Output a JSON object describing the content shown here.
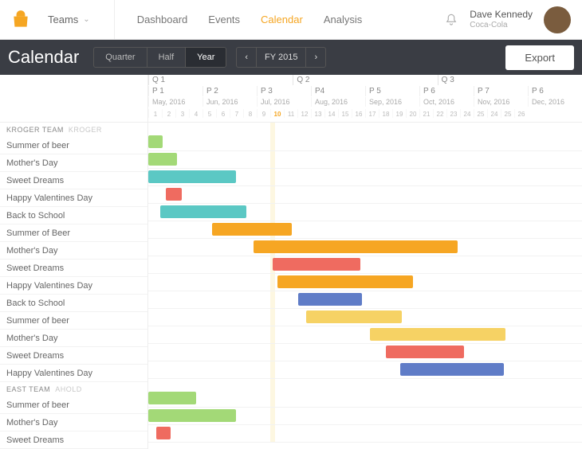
{
  "topbar": {
    "teams_label": "Teams",
    "nav": [
      "Dashboard",
      "Events",
      "Calendar",
      "Analysis"
    ],
    "nav_active": 2,
    "user_name": "Dave Kennedy",
    "user_org": "Coca-Cola"
  },
  "header": {
    "title": "Calendar",
    "segments": [
      "Quarter",
      "Half",
      "Year"
    ],
    "segment_active": 2,
    "period_label": "FY 2015",
    "export_label": "Export"
  },
  "timeline": {
    "quarters": [
      "Q 1",
      "Q 2",
      "Q 3"
    ],
    "periods": [
      "P 1",
      "P 2",
      "P 3",
      "P4",
      "P 5",
      "P 6",
      "P 7",
      "P 6"
    ],
    "months": [
      "May, 2016",
      "Jun, 2016",
      "Jul, 2016",
      "Aug, 2016",
      "Sep, 2016",
      "Oct, 2016",
      "Nov, 2016",
      "Dec, 2016"
    ],
    "days": [
      "1",
      "2",
      "3",
      "4",
      "5",
      "6",
      "7",
      "8",
      "9",
      "10",
      "11",
      "12",
      "13",
      "14",
      "15",
      "16",
      "17",
      "18",
      "19",
      "20",
      "21",
      "22",
      "23",
      "24",
      "25",
      "24",
      "25",
      "26"
    ],
    "day_highlight_index": 9
  },
  "groups": [
    {
      "name": "KROGER TEAM",
      "sub": "KROGER",
      "rows": [
        {
          "label": "Summer of beer",
          "bars": [
            {
              "start": 0,
              "len": 18,
              "cls": "c-green"
            }
          ]
        },
        {
          "label": "Mother's Day",
          "bars": [
            {
              "start": 0,
              "len": 36,
              "cls": "c-green"
            }
          ]
        },
        {
          "label": "Sweet Dreams",
          "bars": [
            {
              "start": 0,
              "len": 110,
              "cls": "c-teal"
            }
          ]
        },
        {
          "label": "Happy Valentines Day",
          "bars": [
            {
              "start": 22,
              "len": 20,
              "cls": "c-red"
            }
          ]
        },
        {
          "label": "Back to School",
          "bars": [
            {
              "start": 15,
              "len": 108,
              "cls": "c-teal"
            }
          ]
        },
        {
          "label": "Summer of Beer",
          "bars": [
            {
              "start": 80,
              "len": 100,
              "cls": "c-orange"
            }
          ]
        },
        {
          "label": "Mother's Day",
          "bars": [
            {
              "start": 132,
              "len": 256,
              "cls": "c-orange"
            }
          ]
        },
        {
          "label": "Sweet Dreams",
          "bars": [
            {
              "start": 156,
              "len": 110,
              "cls": "c-red"
            }
          ]
        },
        {
          "label": "Happy Valentines Day",
          "bars": [
            {
              "start": 162,
              "len": 170,
              "cls": "c-orange"
            }
          ]
        },
        {
          "label": "Back to School",
          "bars": [
            {
              "start": 188,
              "len": 80,
              "cls": "c-blue"
            }
          ]
        },
        {
          "label": "Summer of beer",
          "bars": [
            {
              "start": 198,
              "len": 120,
              "cls": "c-yellow"
            }
          ]
        },
        {
          "label": "Mother's Day",
          "bars": [
            {
              "start": 278,
              "len": 170,
              "cls": "c-yellow"
            }
          ]
        },
        {
          "label": "Sweet Dreams",
          "bars": [
            {
              "start": 298,
              "len": 98,
              "cls": "c-red"
            }
          ]
        },
        {
          "label": "Happy Valentines Day",
          "bars": [
            {
              "start": 316,
              "len": 130,
              "cls": "c-blue"
            }
          ]
        }
      ]
    },
    {
      "name": "EAST TEAM",
      "sub": "AHOLD",
      "rows": [
        {
          "label": "Summer of beer",
          "bars": [
            {
              "start": 0,
              "len": 60,
              "cls": "c-green"
            }
          ]
        },
        {
          "label": "Mother's Day",
          "bars": [
            {
              "start": 0,
              "len": 110,
              "cls": "c-green"
            }
          ]
        },
        {
          "label": "Sweet Dreams",
          "bars": [
            {
              "start": 10,
              "len": 18,
              "cls": "c-red"
            }
          ]
        }
      ]
    }
  ],
  "chart_data": {
    "type": "bar",
    "title": "Calendar Gantt – FY 2015 (Year view)",
    "x_unit": "week index (0 = P1 wk1, 4 weeks per period)",
    "x_range": [
      0,
      32
    ],
    "series": [
      {
        "group": "KROGER TEAM",
        "name": "Summer of beer",
        "start": 0,
        "end": 1,
        "color": "green"
      },
      {
        "group": "KROGER TEAM",
        "name": "Mother's Day",
        "start": 0,
        "end": 2,
        "color": "green"
      },
      {
        "group": "KROGER TEAM",
        "name": "Sweet Dreams",
        "start": 0,
        "end": 6.5,
        "color": "teal"
      },
      {
        "group": "KROGER TEAM",
        "name": "Happy Valentines Day",
        "start": 1.3,
        "end": 2.4,
        "color": "red"
      },
      {
        "group": "KROGER TEAM",
        "name": "Back to School",
        "start": 0.9,
        "end": 7.2,
        "color": "teal"
      },
      {
        "group": "KROGER TEAM",
        "name": "Summer of Beer",
        "start": 4.7,
        "end": 10.6,
        "color": "orange"
      },
      {
        "group": "KROGER TEAM",
        "name": "Mother's Day",
        "start": 7.8,
        "end": 22.8,
        "color": "orange"
      },
      {
        "group": "KROGER TEAM",
        "name": "Sweet Dreams",
        "start": 9.2,
        "end": 15.6,
        "color": "red"
      },
      {
        "group": "KROGER TEAM",
        "name": "Happy Valentines Day",
        "start": 9.5,
        "end": 19.5,
        "color": "orange"
      },
      {
        "group": "KROGER TEAM",
        "name": "Back to School",
        "start": 11.1,
        "end": 15.8,
        "color": "blue"
      },
      {
        "group": "KROGER TEAM",
        "name": "Summer of beer",
        "start": 11.6,
        "end": 18.7,
        "color": "yellow"
      },
      {
        "group": "KROGER TEAM",
        "name": "Mother's Day",
        "start": 16.4,
        "end": 26.4,
        "color": "yellow"
      },
      {
        "group": "KROGER TEAM",
        "name": "Sweet Dreams",
        "start": 17.5,
        "end": 23.3,
        "color": "red"
      },
      {
        "group": "KROGER TEAM",
        "name": "Happy Valentines Day",
        "start": 18.6,
        "end": 26.2,
        "color": "blue"
      },
      {
        "group": "EAST TEAM",
        "name": "Summer of beer",
        "start": 0,
        "end": 3.5,
        "color": "green"
      },
      {
        "group": "EAST TEAM",
        "name": "Mother's Day",
        "start": 0,
        "end": 6.5,
        "color": "green"
      },
      {
        "group": "EAST TEAM",
        "name": "Sweet Dreams",
        "start": 0.6,
        "end": 1.6,
        "color": "red"
      }
    ]
  }
}
